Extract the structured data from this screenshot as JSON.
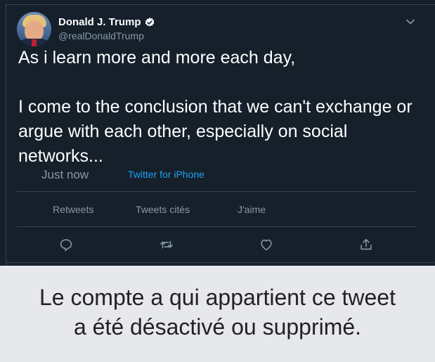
{
  "tweet": {
    "author_name": "Donald J. Trump",
    "author_handle": "@realDonaldTrump",
    "paragraphs": [
      "As i learn more and more each day,",
      "I come to the conclusion that we can't exchange or argue with each other, especially on social networks..."
    ],
    "timestamp": "Just now",
    "source": "Twitter for iPhone"
  },
  "stats": {
    "retweets_label": "Retweets",
    "quotes_label": "Tweets cités",
    "likes_label": "J'aime"
  },
  "actions": [
    "reply-icon",
    "retweet-icon",
    "like-icon",
    "share-icon"
  ],
  "notice": {
    "line1": "Le compte a qui appartient ce tweet",
    "line2": "a été désactivé ou supprimé."
  },
  "colors": {
    "background": "#15202b",
    "text": "#ffffff",
    "muted": "#8899a6",
    "link": "#1da1f2",
    "verified": "#ffffff",
    "notice_bg": "#e6e8ec"
  }
}
